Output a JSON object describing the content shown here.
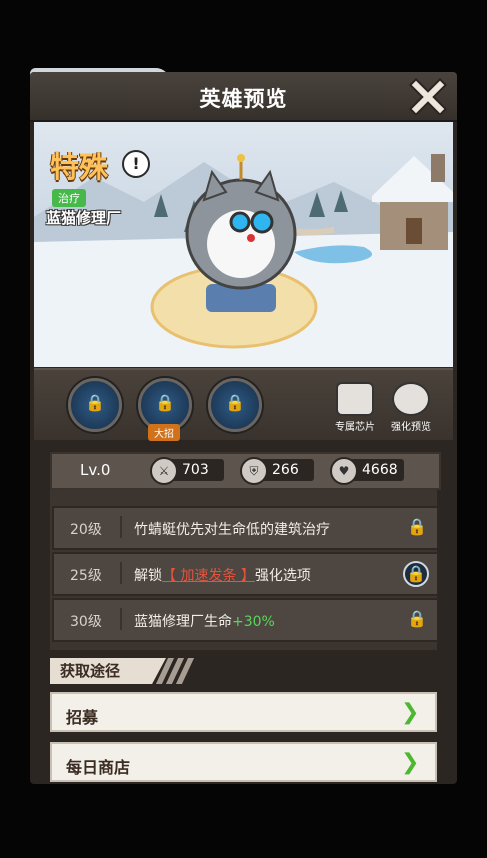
{
  "window": {
    "title": "英雄预览"
  },
  "hero": {
    "type": "特殊",
    "role": "治疗",
    "name": "蓝猫修理厂"
  },
  "skills": {
    "ult_tag": "大招",
    "chip_label": "专属芯片",
    "enhance_label": "强化预览"
  },
  "stats": {
    "level": "Lv.0",
    "attack": "703",
    "defense": "266",
    "hp": "4668"
  },
  "unlocks": [
    {
      "level": "20级",
      "text": "竹蜻蜓优先对生命低的建筑治疗"
    },
    {
      "level": "25级",
      "prefix": "解锁",
      "highlight": "【 加速发条 】",
      "suffix": "强化选项"
    },
    {
      "level": "30级",
      "text": "蓝猫修理厂生命",
      "bonus": "+30%"
    }
  ],
  "sources": {
    "header": "获取途径",
    "items": [
      "招募",
      "每日商店"
    ]
  },
  "icons": {
    "close": "close-icon",
    "lock": "lock-icon",
    "eye": "eye-icon",
    "chip": "chip-icon",
    "arrow": "chevron-right-icon"
  },
  "colors": {
    "accent_orange": "#ffc25a",
    "role_green": "#46b94a",
    "bonus_green": "#58d65c",
    "highlight_red": "#e5533d"
  }
}
